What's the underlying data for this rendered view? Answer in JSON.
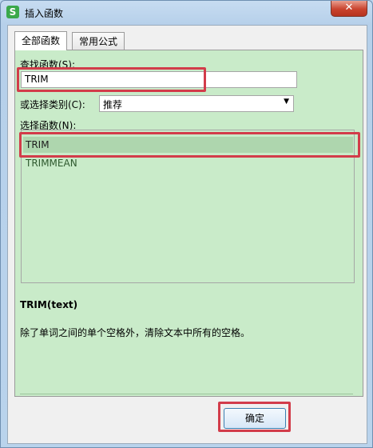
{
  "window": {
    "title": "插入函数",
    "icon_text": "S",
    "close_glyph": "✕"
  },
  "tabs": [
    {
      "label": "全部函数"
    },
    {
      "label": "常用公式"
    }
  ],
  "search": {
    "label": "查找函数(S):",
    "value": "TRIM"
  },
  "category": {
    "label": "或选择类别(C):",
    "selected": "推荐"
  },
  "functions": {
    "label": "选择函数(N):",
    "items": [
      "TRIM",
      "TRIMMEAN"
    ],
    "selected_index": 0
  },
  "detail": {
    "syntax": "TRIM(text)",
    "description": "除了单词之间的单个空格外，清除文本中所有的空格。"
  },
  "buttons": {
    "ok": "确定"
  },
  "colors": {
    "highlight": "#d23c4a",
    "panel": "#c9ebc9",
    "selected_row": "#aed6ae"
  }
}
